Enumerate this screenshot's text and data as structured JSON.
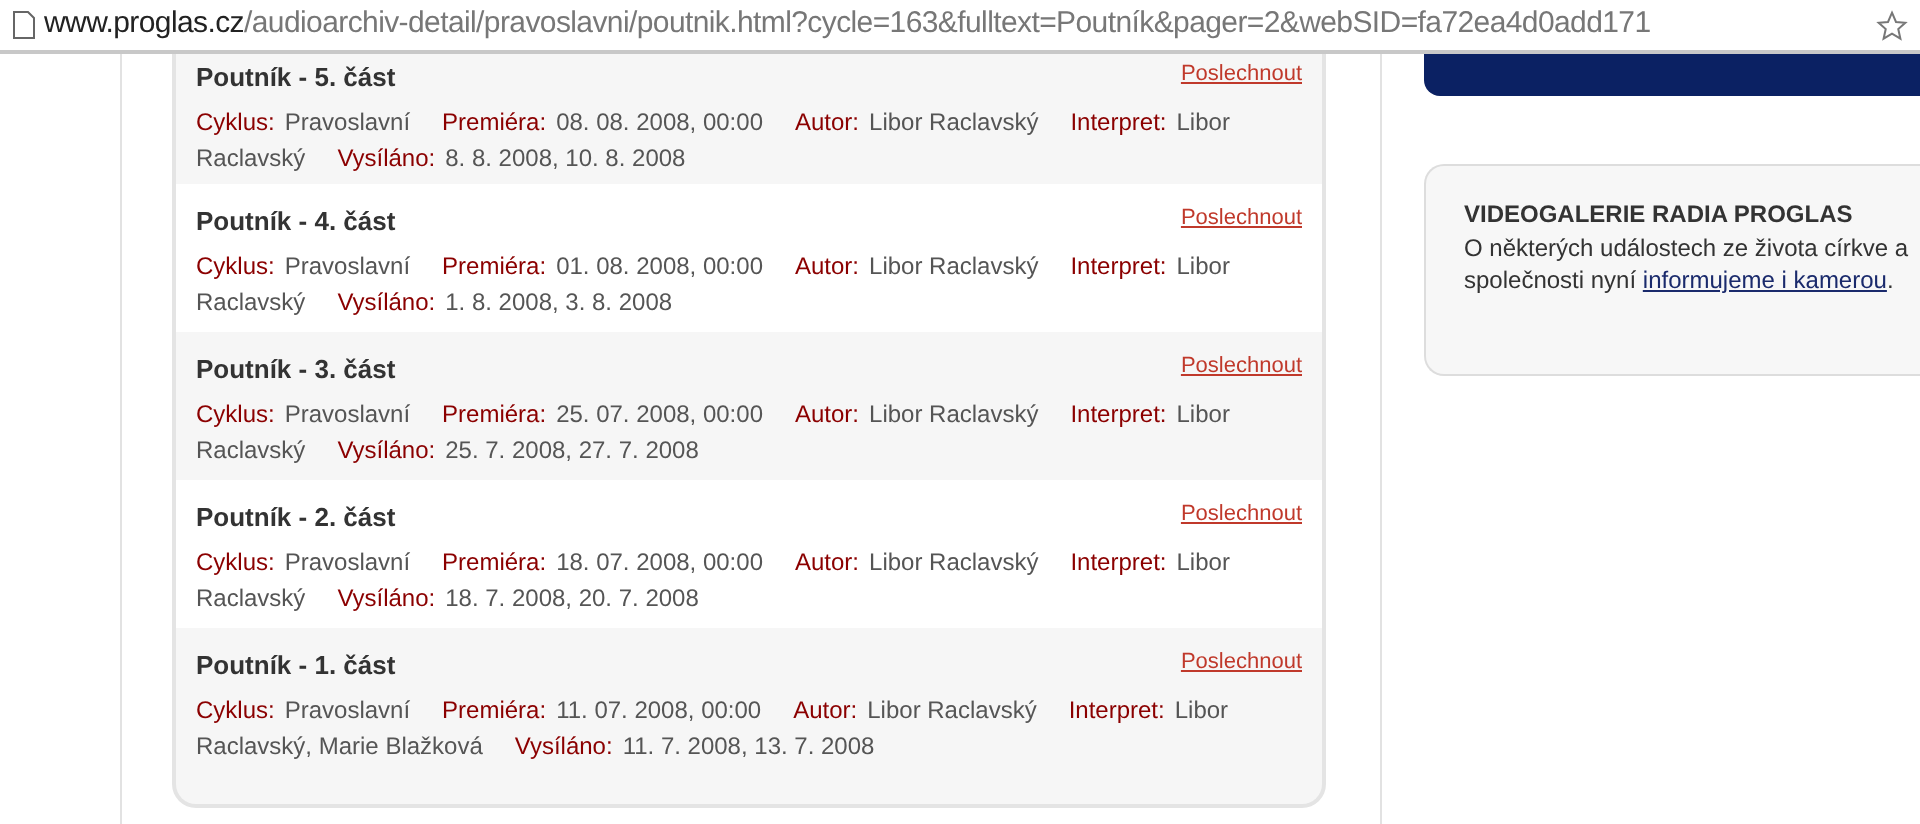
{
  "address_bar": {
    "host": "www.proglas.cz",
    "path": "/audioarchiv-detail/pravoslavni/poutnik.html?cycle=163&fulltext=Poutník&pager=2&webSID=fa72ea4d0add171"
  },
  "episodes": [
    {
      "title": "Poutník - 5. část",
      "link": "Poslechnout",
      "fields": [
        {
          "label": "Cyklus:",
          "value": "Pravoslavní"
        },
        {
          "label": "Premiéra:",
          "value": "08. 08. 2008, 00:00"
        },
        {
          "label": "Autor:",
          "value": "Libor Raclavský"
        },
        {
          "label": "Interpret:",
          "value": "Libor Raclavský"
        },
        {
          "label": "Vysíláno:",
          "value": "8. 8. 2008, 10. 8. 2008"
        }
      ]
    },
    {
      "title": "Poutník - 4. část",
      "link": "Poslechnout",
      "fields": [
        {
          "label": "Cyklus:",
          "value": "Pravoslavní"
        },
        {
          "label": "Premiéra:",
          "value": "01. 08. 2008, 00:00"
        },
        {
          "label": "Autor:",
          "value": "Libor Raclavský"
        },
        {
          "label": "Interpret:",
          "value": "Libor Raclavský"
        },
        {
          "label": "Vysíláno:",
          "value": "1. 8. 2008, 3. 8. 2008"
        }
      ]
    },
    {
      "title": "Poutník - 3. část",
      "link": "Poslechnout",
      "fields": [
        {
          "label": "Cyklus:",
          "value": "Pravoslavní"
        },
        {
          "label": "Premiéra:",
          "value": "25. 07. 2008, 00:00"
        },
        {
          "label": "Autor:",
          "value": "Libor Raclavský"
        },
        {
          "label": "Interpret:",
          "value": "Libor Raclavský"
        },
        {
          "label": "Vysíláno:",
          "value": "25. 7. 2008, 27. 7. 2008"
        }
      ]
    },
    {
      "title": "Poutník - 2. část",
      "link": "Poslechnout",
      "fields": [
        {
          "label": "Cyklus:",
          "value": "Pravoslavní"
        },
        {
          "label": "Premiéra:",
          "value": "18. 07. 2008, 00:00"
        },
        {
          "label": "Autor:",
          "value": "Libor Raclavský"
        },
        {
          "label": "Interpret:",
          "value": "Libor Raclavský"
        },
        {
          "label": "Vysíláno:",
          "value": "18. 7. 2008, 20. 7. 2008"
        }
      ]
    },
    {
      "title": "Poutník - 1. část",
      "link": "Poslechnout",
      "fields": [
        {
          "label": "Cyklus:",
          "value": "Pravoslavní"
        },
        {
          "label": "Premiéra:",
          "value": "11. 07. 2008, 00:00"
        },
        {
          "label": "Autor:",
          "value": "Libor Raclavský"
        },
        {
          "label": "Interpret:",
          "value": "Libor Raclavský, Marie Blažková"
        },
        {
          "label": "Vysíláno:",
          "value": "11. 7. 2008, 13. 7. 2008"
        }
      ]
    }
  ],
  "video_gallery": {
    "heading": "VIDEOGALERIE RADIA PROGLAS",
    "text": "O některých událostech ze života církve a společnosti nyní",
    "link": "informujeme i kamerou",
    "after_link": "."
  }
}
